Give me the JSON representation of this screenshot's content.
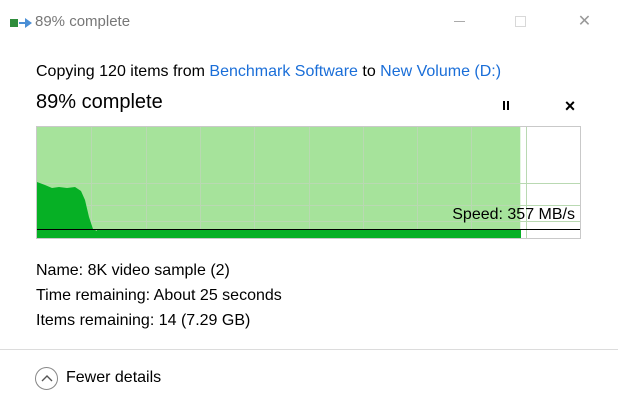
{
  "window": {
    "title": "89% complete",
    "icon": "file-copy-icon",
    "controls": {
      "minimize": "minimize-icon",
      "maximize": "maximize-icon",
      "close": "✕"
    }
  },
  "copy": {
    "prefix": "Copying 120 items from ",
    "source": "Benchmark Software",
    "middle": " to ",
    "destination": "New Volume (D:)",
    "percent_text": "89% complete",
    "progress": 0.89
  },
  "controls": {
    "stop_glyph": "×"
  },
  "graph": {
    "speed_text": "Speed: 357 MB/s",
    "colors": {
      "progress_fill": "#a6e39b",
      "speed_fill": "#06b025",
      "grid": "#b9d9b2"
    }
  },
  "details": {
    "name_label": "Name:",
    "name_value": "8K video sample (2)",
    "time_label": "Time remaining:",
    "time_value": "About 25 seconds",
    "items_label": "Items remaining:",
    "items_value": "14 (7.29 GB)"
  },
  "footer": {
    "toggle_label": "Fewer details"
  },
  "colors": {
    "link": "#1a6ed8"
  }
}
